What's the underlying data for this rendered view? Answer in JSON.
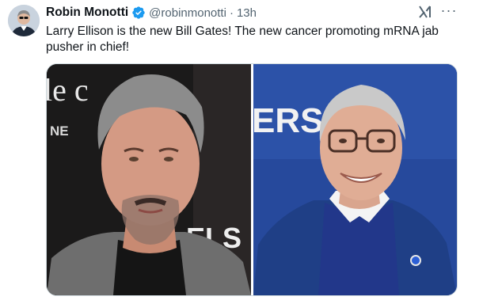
{
  "tweet": {
    "author": {
      "name": "Robin Monotti",
      "handle": "@robinmonotti",
      "verified_icon": "verified-badge-icon",
      "avatar_icon": "avatar"
    },
    "separator": "·",
    "time": "13h",
    "text": "Larry Ellison is the new Bill Gates! The new cancer promoting mRNA jab pusher in chief!",
    "actions": {
      "grok_icon": "grok-icon",
      "more_label": "···"
    },
    "media": {
      "left_photo_backdrop_text": [
        "le c",
        "NE",
        "ELS"
      ],
      "right_photo_backdrop_text": [
        "ERS"
      ]
    }
  },
  "colors": {
    "verified": "#1d9bf0",
    "secondary_text": "#536471",
    "border": "#cfd9de"
  }
}
